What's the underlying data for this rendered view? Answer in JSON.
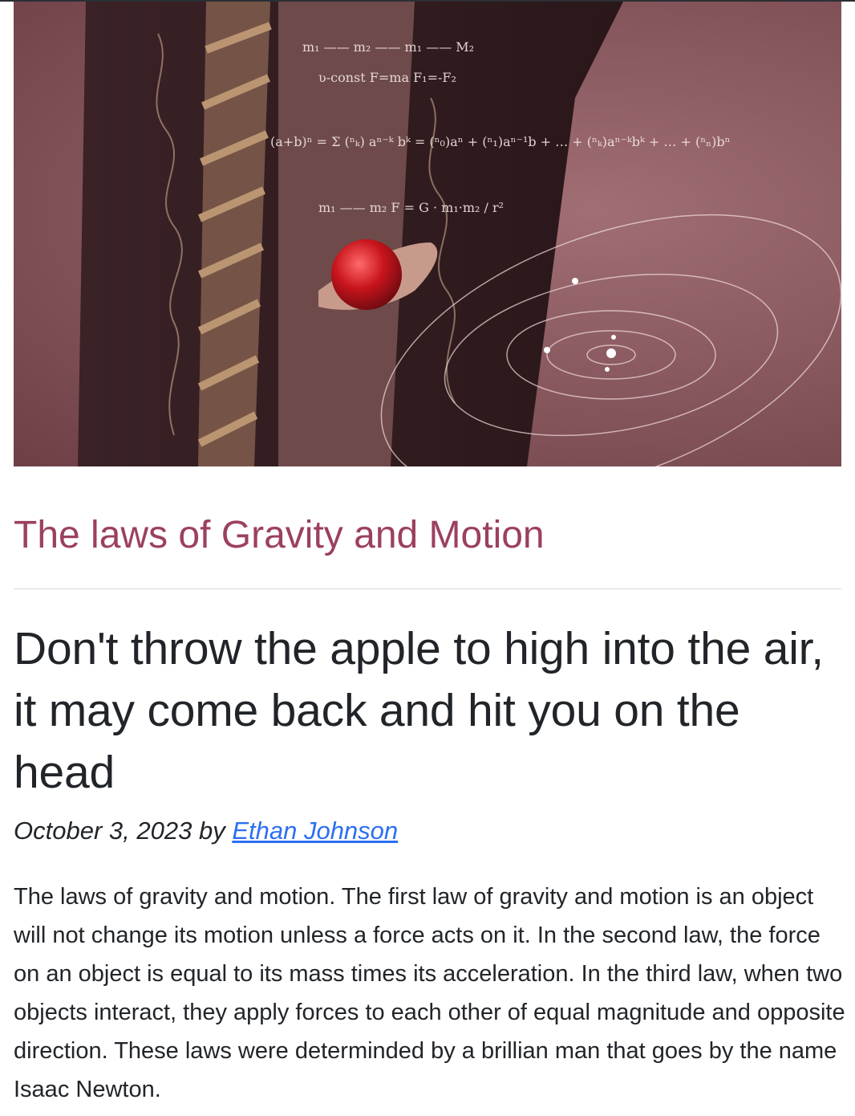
{
  "article": {
    "image_alt": "Man holding a red apple in front of a chalkboard with physics equations and orbits",
    "category": "The laws of Gravity and Motion",
    "headline": "Don't throw the apple to high into the air, it may come back and hit you on the head",
    "date": "October 3, 2023",
    "by": "by",
    "author": "Ethan Johnson",
    "body": "The laws of gravity and motion. The first law of gravity and motion is an object will not change its motion unless a force acts on it. In the second law, the force on an object is equal to its mass times its acceleration. In the third law, when two objects interact, they apply forces to each other of equal magnitude and opposite direction. These laws were determinded by a brillian man that goes by the name Isaac Newton."
  },
  "colors": {
    "category": "#9c405f",
    "link": "#2b6ff2",
    "text": "#212529"
  }
}
